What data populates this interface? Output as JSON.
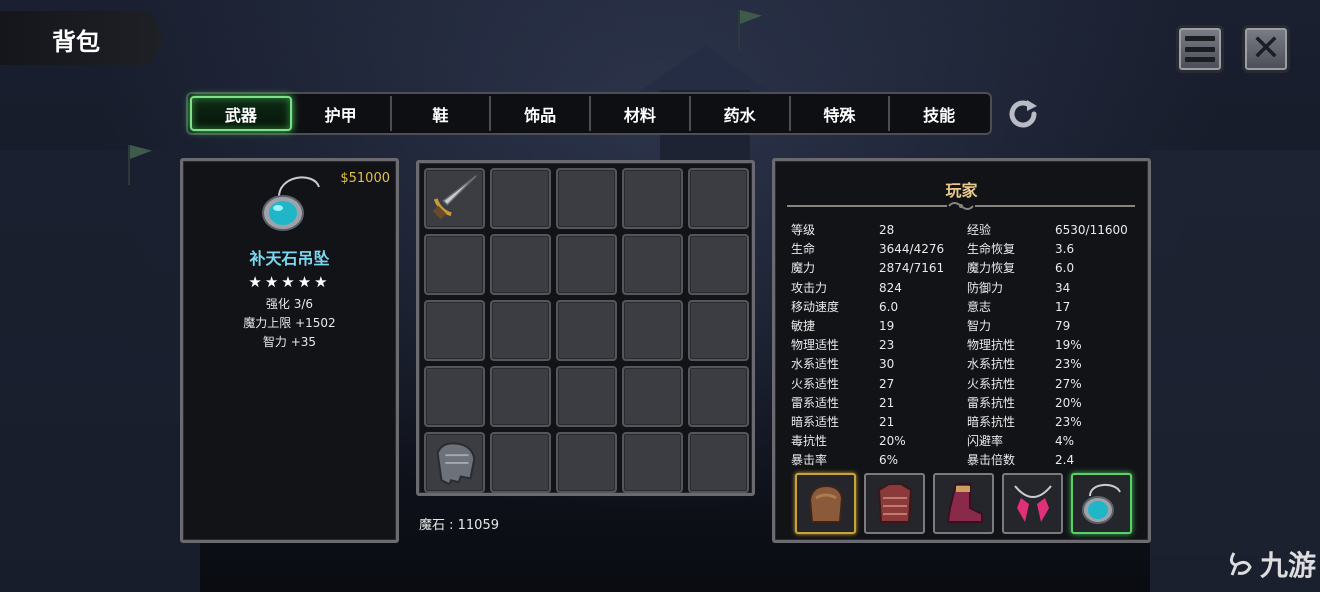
{
  "header": {
    "title": "背包"
  },
  "controls": {
    "menu_icon": "hamburger-menu-icon",
    "close_icon": "close-x-icon",
    "refresh_icon": "refresh-icon"
  },
  "tabs": [
    {
      "label": "武器",
      "active": true
    },
    {
      "label": "护甲",
      "active": false
    },
    {
      "label": "鞋",
      "active": false
    },
    {
      "label": "饰品",
      "active": false
    },
    {
      "label": "材料",
      "active": false
    },
    {
      "label": "药水",
      "active": false
    },
    {
      "label": "特殊",
      "active": false
    },
    {
      "label": "技能",
      "active": false
    }
  ],
  "selected_item": {
    "price": "$51000",
    "name": "补天石吊坠",
    "stars": "★★★★★",
    "star_count": 5,
    "icon": "turquoise-pendant-icon",
    "lines": [
      "强化 3/6",
      "魔力上限  +1502",
      "智力  +35"
    ]
  },
  "inventory": {
    "slots": [
      "sword-icon",
      "",
      "",
      "",
      "",
      "",
      "",
      "",
      "",
      "",
      "",
      "",
      "",
      "",
      "",
      "",
      "",
      "",
      "",
      "",
      "gauntlet-icon",
      "",
      "",
      "",
      ""
    ],
    "magic_stone": "魔石 : 11059"
  },
  "player": {
    "title": "玩家",
    "stats": [
      [
        "等级",
        "28",
        "经验",
        "6530/11600"
      ],
      [
        "生命",
        "3644/4276",
        "生命恢复",
        "3.6"
      ],
      [
        "魔力",
        "2874/7161",
        "魔力恢复",
        "6.0"
      ],
      [
        "攻击力",
        "824",
        "防御力",
        "34"
      ],
      [
        "移动速度",
        "6.0",
        "意志",
        "17"
      ],
      [
        "敏捷",
        "19",
        "智力",
        "79"
      ],
      [
        "物理适性",
        "23",
        "物理抗性",
        "19%"
      ],
      [
        "水系适性",
        "30",
        "水系抗性",
        "23%"
      ],
      [
        "火系适性",
        "27",
        "火系抗性",
        "27%"
      ],
      [
        "雷系适性",
        "21",
        "雷系抗性",
        "20%"
      ],
      [
        "暗系适性",
        "21",
        "暗系抗性",
        "23%"
      ],
      [
        "毒抗性",
        "20%",
        "闪避率",
        "4%"
      ],
      [
        "暴击率",
        "6%",
        "暴击倍数",
        "2.4"
      ]
    ],
    "equipment": [
      {
        "icon": "gauntlet-equip-icon",
        "highlight": "gold"
      },
      {
        "icon": "armor-equip-icon",
        "highlight": "none"
      },
      {
        "icon": "boots-equip-icon",
        "highlight": "none"
      },
      {
        "icon": "pink-necklace-equip-icon",
        "highlight": "none"
      },
      {
        "icon": "turquoise-pendant-equip-icon",
        "highlight": "green"
      }
    ]
  },
  "watermark": {
    "text": "九游"
  },
  "colors": {
    "accent_green": "#7fe08a",
    "price_gold": "#e0c24a",
    "item_name": "#7ad8f0",
    "player_title": "#e8c98a"
  }
}
